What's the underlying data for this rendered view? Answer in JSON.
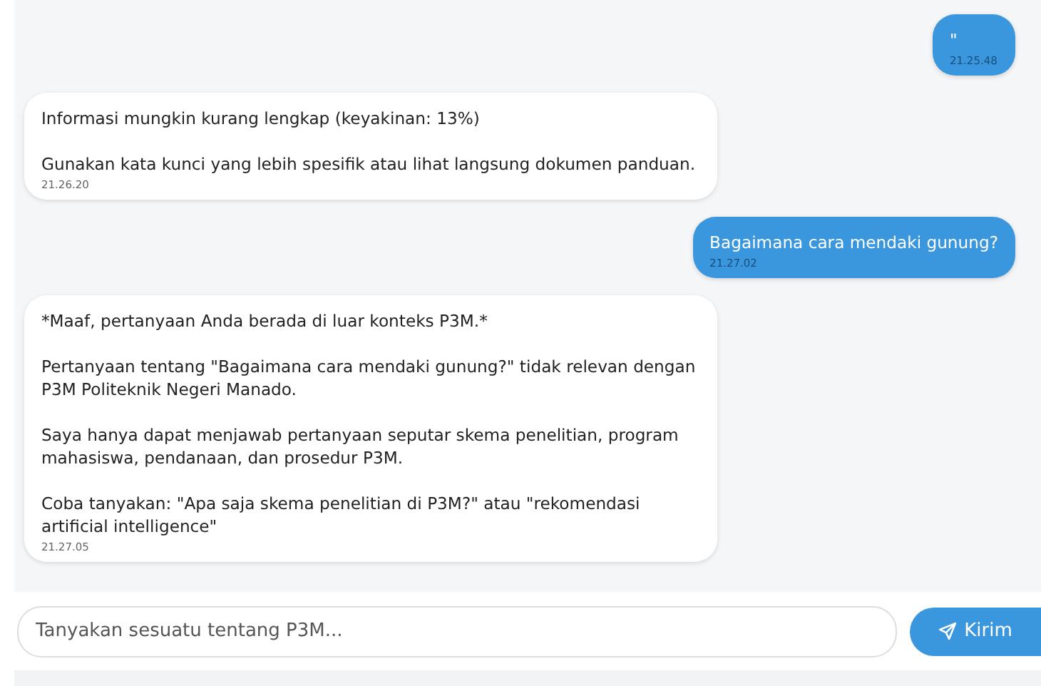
{
  "messages": [
    {
      "kind": "user",
      "paragraphs": [
        "\""
      ],
      "time": "21.25.48"
    },
    {
      "kind": "bot",
      "paragraphs": [
        "Informasi mungkin kurang lengkap (keyakinan: 13%)",
        "Gunakan kata kunci yang lebih spesifik atau lihat langsung dokumen panduan."
      ],
      "time": "21.26.20"
    },
    {
      "kind": "user",
      "paragraphs": [
        "Bagaimana cara mendaki gunung?"
      ],
      "time": "21.27.02"
    },
    {
      "kind": "bot",
      "paragraphs": [
        "*Maaf, pertanyaan Anda berada di luar konteks P3M.*",
        "Pertanyaan tentang \"Bagaimana cara mendaki gunung?\" tidak relevan dengan P3M Politeknik Negeri Manado.",
        "Saya hanya dapat menjawab pertanyaan seputar skema penelitian, program mahasiswa, pendanaan, dan prosedur P3M.",
        "Coba tanyakan: \"Apa saja skema penelitian di P3M?\" atau \"rekomendasi artificial intelligence\""
      ],
      "time": "21.27.05"
    }
  ],
  "input": {
    "placeholder": "Tanyakan sesuatu tentang P3M..."
  },
  "send_button": {
    "label": "Kirim"
  }
}
